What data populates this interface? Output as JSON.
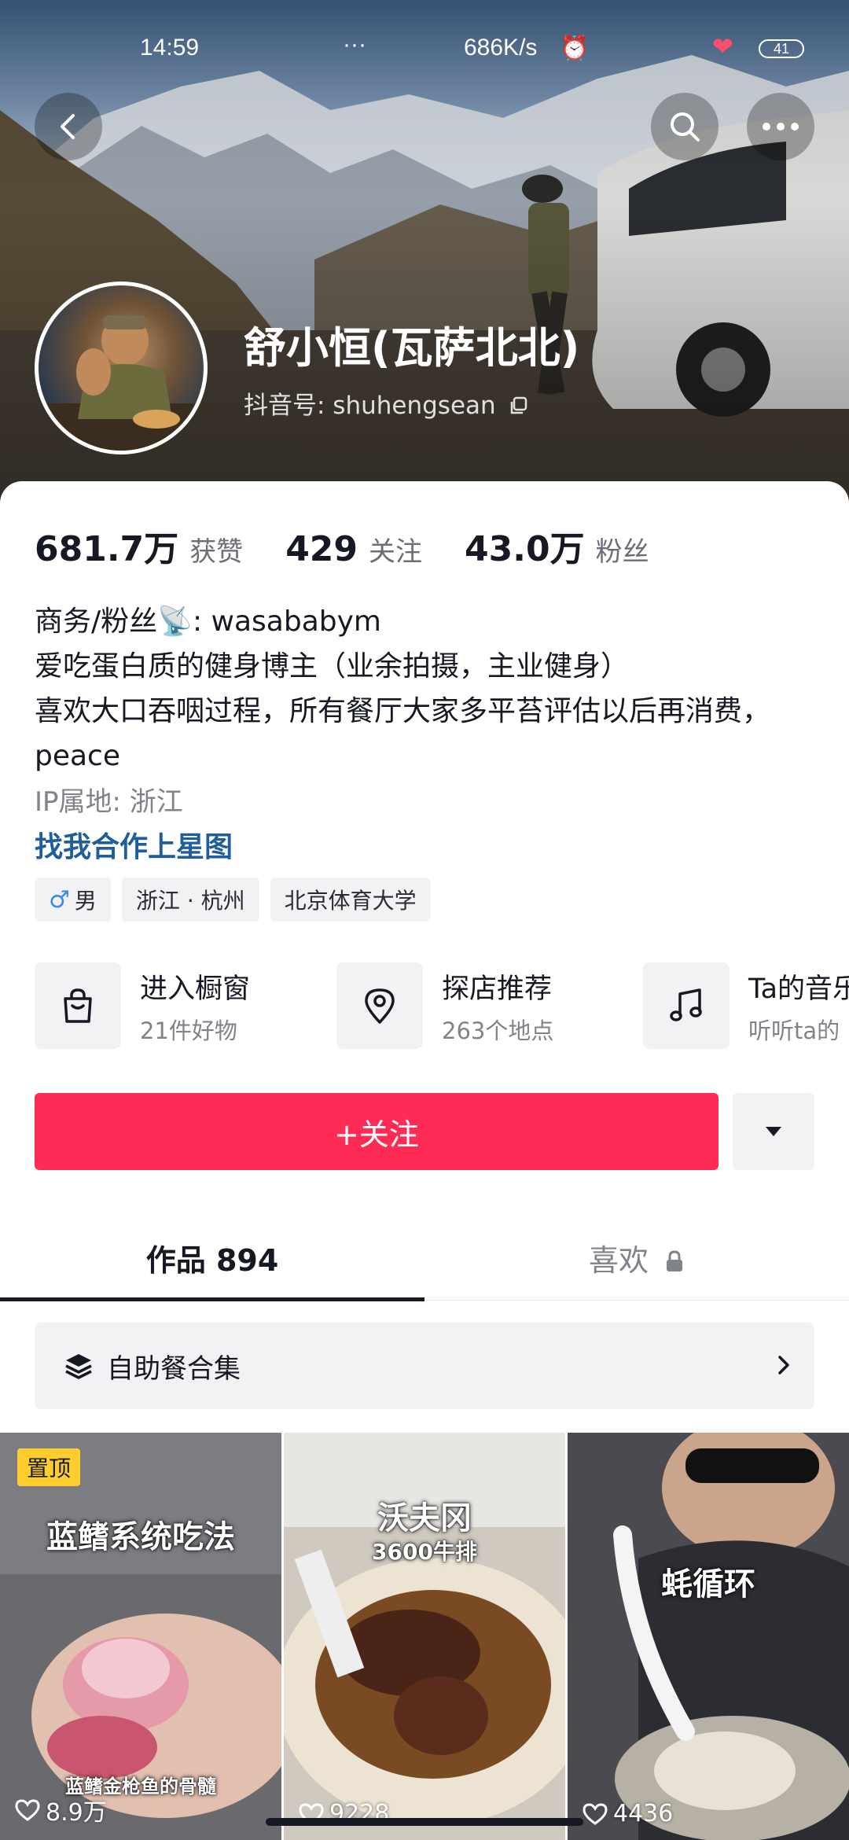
{
  "status_bar": {
    "time": "14:59",
    "dots": "···",
    "network_speed": "686K/s",
    "battery": "41"
  },
  "profile": {
    "nickname": "舒小恒(瓦萨北北)",
    "douyin_id": "抖音号: shuhengsean"
  },
  "stats": [
    {
      "value": "681.7万",
      "label": "获赞"
    },
    {
      "value": "429",
      "label": "关注"
    },
    {
      "value": "43.0万",
      "label": "粉丝"
    }
  ],
  "bio": {
    "line1": "商务/粉丝📡: wasababym",
    "line2": "爱吃蛋白质的健身博主（业余拍摄，主业健身）",
    "line3": "喜欢大口吞咽过程，所有餐厅大家多平苔评估以后再消费，peace"
  },
  "ip_location": "IP属地: 浙江",
  "link_text": "找我合作上星图",
  "tags": {
    "gender": "男",
    "location": "浙江 · 杭州",
    "school": "北京体育大学"
  },
  "features": [
    {
      "icon": "shopping-bag-icon",
      "title": "进入橱窗",
      "subtitle": "21件好物"
    },
    {
      "icon": "location-pin-icon",
      "title": "探店推荐",
      "subtitle": "263个地点"
    },
    {
      "icon": "music-note-icon",
      "title": "Ta的音乐",
      "subtitle": "听听ta的"
    }
  ],
  "follow_label": "+关注",
  "tabs": {
    "works": "作品 894",
    "likes": "喜欢"
  },
  "collection_label": "自助餐合集",
  "videos": [
    {
      "pinned_label": "置顶",
      "caption": "蓝鳍系统吃法",
      "sub_caption": "蓝鳍金枪鱼的骨髓",
      "likes": "8.9万"
    },
    {
      "caption": "沃夫冈",
      "sub_caption": "3600牛排",
      "likes": "9228"
    },
    {
      "caption": "蚝循环",
      "likes": "4436"
    }
  ],
  "colors": {
    "accent": "#fe2c55",
    "link": "#1f5d9b",
    "pin": "#fecd2e"
  }
}
